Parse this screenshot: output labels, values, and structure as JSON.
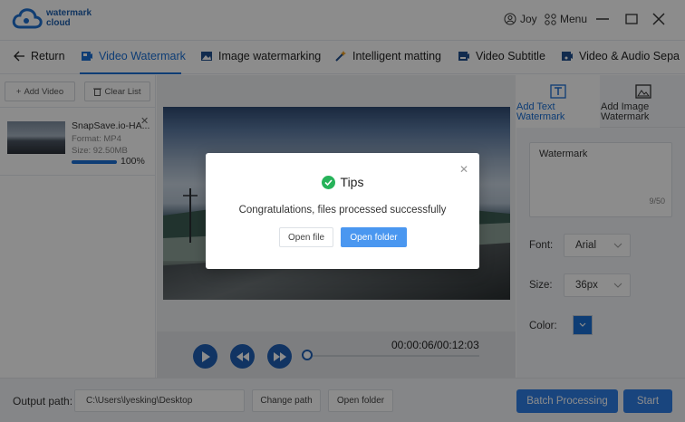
{
  "app": {
    "logo_line1": "watermark",
    "logo_line2": "cloud",
    "user_name": "Joy",
    "menu_label": "Menu"
  },
  "nav": {
    "return_label": "Return",
    "tabs": [
      {
        "label": "Video Watermark",
        "active": true,
        "icon": "video-icon"
      },
      {
        "label": "Image watermarking",
        "active": false,
        "icon": "image-icon"
      },
      {
        "label": "Intelligent matting",
        "active": false,
        "icon": "magic-wand-icon"
      },
      {
        "label": "Video Subtitle",
        "active": false,
        "icon": "subtitle-icon"
      },
      {
        "label": "Video & Audio Sepa",
        "active": false,
        "icon": "audio-icon"
      }
    ]
  },
  "left_panel": {
    "add_video_label": "Add Video",
    "clear_list_label": "Clear List",
    "file": {
      "name": "SnapSave.io-HA...",
      "format": "Format:  MP4",
      "size": "Size:  92.50MB",
      "progress_percent": 100,
      "progress_label": "100%"
    }
  },
  "player": {
    "time": "00:00:06/00:12:03"
  },
  "right_panel": {
    "tab_text": "Add Text Watermark",
    "tab_image": "Add Image Watermark",
    "watermark_text": "Watermark",
    "char_count": "9/50",
    "font_label": "Font:",
    "font_value": "Arial",
    "size_label": "Size:",
    "size_value": "36px",
    "color_label": "Color:",
    "color_value": "#1a6fd6"
  },
  "footer": {
    "output_label": "Output path:",
    "output_path": "C:\\Users\\lyesking\\Desktop",
    "change_path_label": "Change path",
    "open_folder_label": "Open folder",
    "batch_label": "Batch Processing",
    "start_label": "Start"
  },
  "modal": {
    "title": "Tips",
    "message": "Congratulations, files processed successfully",
    "open_file_label": "Open file",
    "open_folder_label": "Open folder"
  }
}
